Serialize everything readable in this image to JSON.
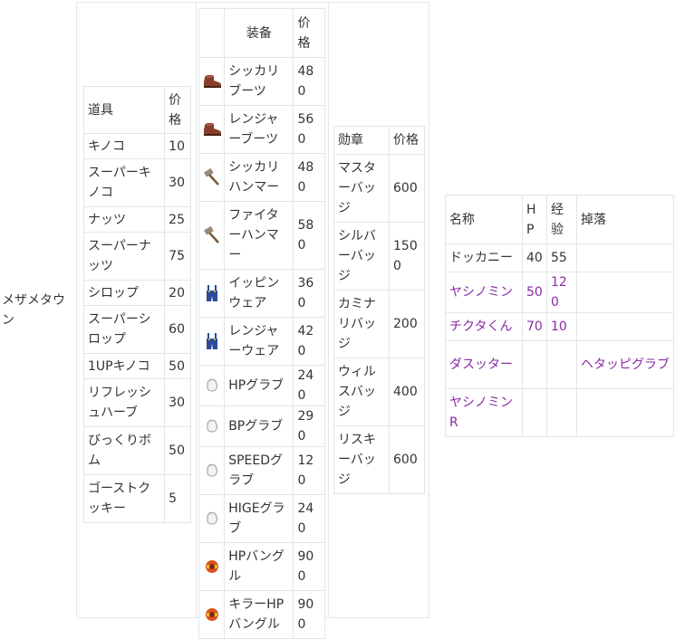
{
  "region": "メザメタウン",
  "items": {
    "headers": [
      "道具",
      "价格"
    ],
    "rows": [
      {
        "name": "キノコ",
        "price": "10"
      },
      {
        "name": "スーパーキノコ",
        "price": "30"
      },
      {
        "name": "ナッツ",
        "price": "25"
      },
      {
        "name": "スーパーナッツ",
        "price": "75"
      },
      {
        "name": "シロップ",
        "price": "20"
      },
      {
        "name": "スーパーシロップ",
        "price": "60"
      },
      {
        "name": "1UPキノコ",
        "price": "50"
      },
      {
        "name": "リフレッシュハーブ",
        "price": "30"
      },
      {
        "name": "びっくりボム",
        "price": "50"
      },
      {
        "name": "ゴーストクッキー",
        "price": "5"
      }
    ]
  },
  "equipment": {
    "headers": [
      "",
      "装备",
      "价格"
    ],
    "rows": [
      {
        "icon": "boots-icon",
        "name": "シッカリブーツ",
        "price": "480"
      },
      {
        "icon": "boots-icon",
        "name": "レンジャーブーツ",
        "price": "560"
      },
      {
        "icon": "hammer-icon",
        "name": "シッカリハンマー",
        "price": "480"
      },
      {
        "icon": "hammer-icon",
        "name": "ファイターハンマー",
        "price": "580"
      },
      {
        "icon": "overalls-icon",
        "name": "イッピンウェア",
        "price": "360"
      },
      {
        "icon": "overalls-icon",
        "name": "レンジャーウェア",
        "price": "420"
      },
      {
        "icon": "glove-icon",
        "name": "HPグラブ",
        "price": "240"
      },
      {
        "icon": "glove-icon",
        "name": "BPグラブ",
        "price": "290"
      },
      {
        "icon": "glove-icon",
        "name": "SPEEDグラブ",
        "price": "120"
      },
      {
        "icon": "glove-icon",
        "name": "HIGEグラブ",
        "price": "240"
      },
      {
        "icon": "bangle-icon",
        "name": "HPバングル",
        "price": "900"
      },
      {
        "icon": "bangle-icon",
        "name": "キラーHPバングル",
        "price": "900"
      }
    ]
  },
  "badges": {
    "headers": [
      "勋章",
      "价格"
    ],
    "rows": [
      {
        "name": "マスタ\nーバッ\nジ",
        "price": "600"
      },
      {
        "name": "シルバ\nーバッ\nジ",
        "price": "1500"
      },
      {
        "name": "カミナ\nリバッ\nジ",
        "price": "200"
      },
      {
        "name": "ウィル\nスバッ\nジ",
        "price": "400"
      },
      {
        "name": "リスキ\nーバッ\nジ",
        "price": "600"
      }
    ]
  },
  "enemies": {
    "headers": [
      "名称",
      "HP",
      "经验",
      "掉落"
    ],
    "rows": [
      {
        "name": "ドッカニー",
        "hp": "40",
        "exp": "55",
        "drop": "",
        "link": false
      },
      {
        "name": "ヤシノミン",
        "hp": "50",
        "exp": "120",
        "drop": "",
        "link": true
      },
      {
        "name": "チクタくん",
        "hp": "70",
        "exp": "10",
        "drop": "",
        "link": true
      },
      {
        "name": "ダスッター",
        "hp": "",
        "exp": "",
        "drop": "ヘタッピグラブ",
        "link": true
      },
      {
        "name": "ヤシノミンR",
        "hp": "",
        "exp": "",
        "drop": "",
        "link": true
      }
    ]
  },
  "colors": {
    "link": "#8a2aa6",
    "border": "#dfe6ea",
    "text": "#333333"
  }
}
